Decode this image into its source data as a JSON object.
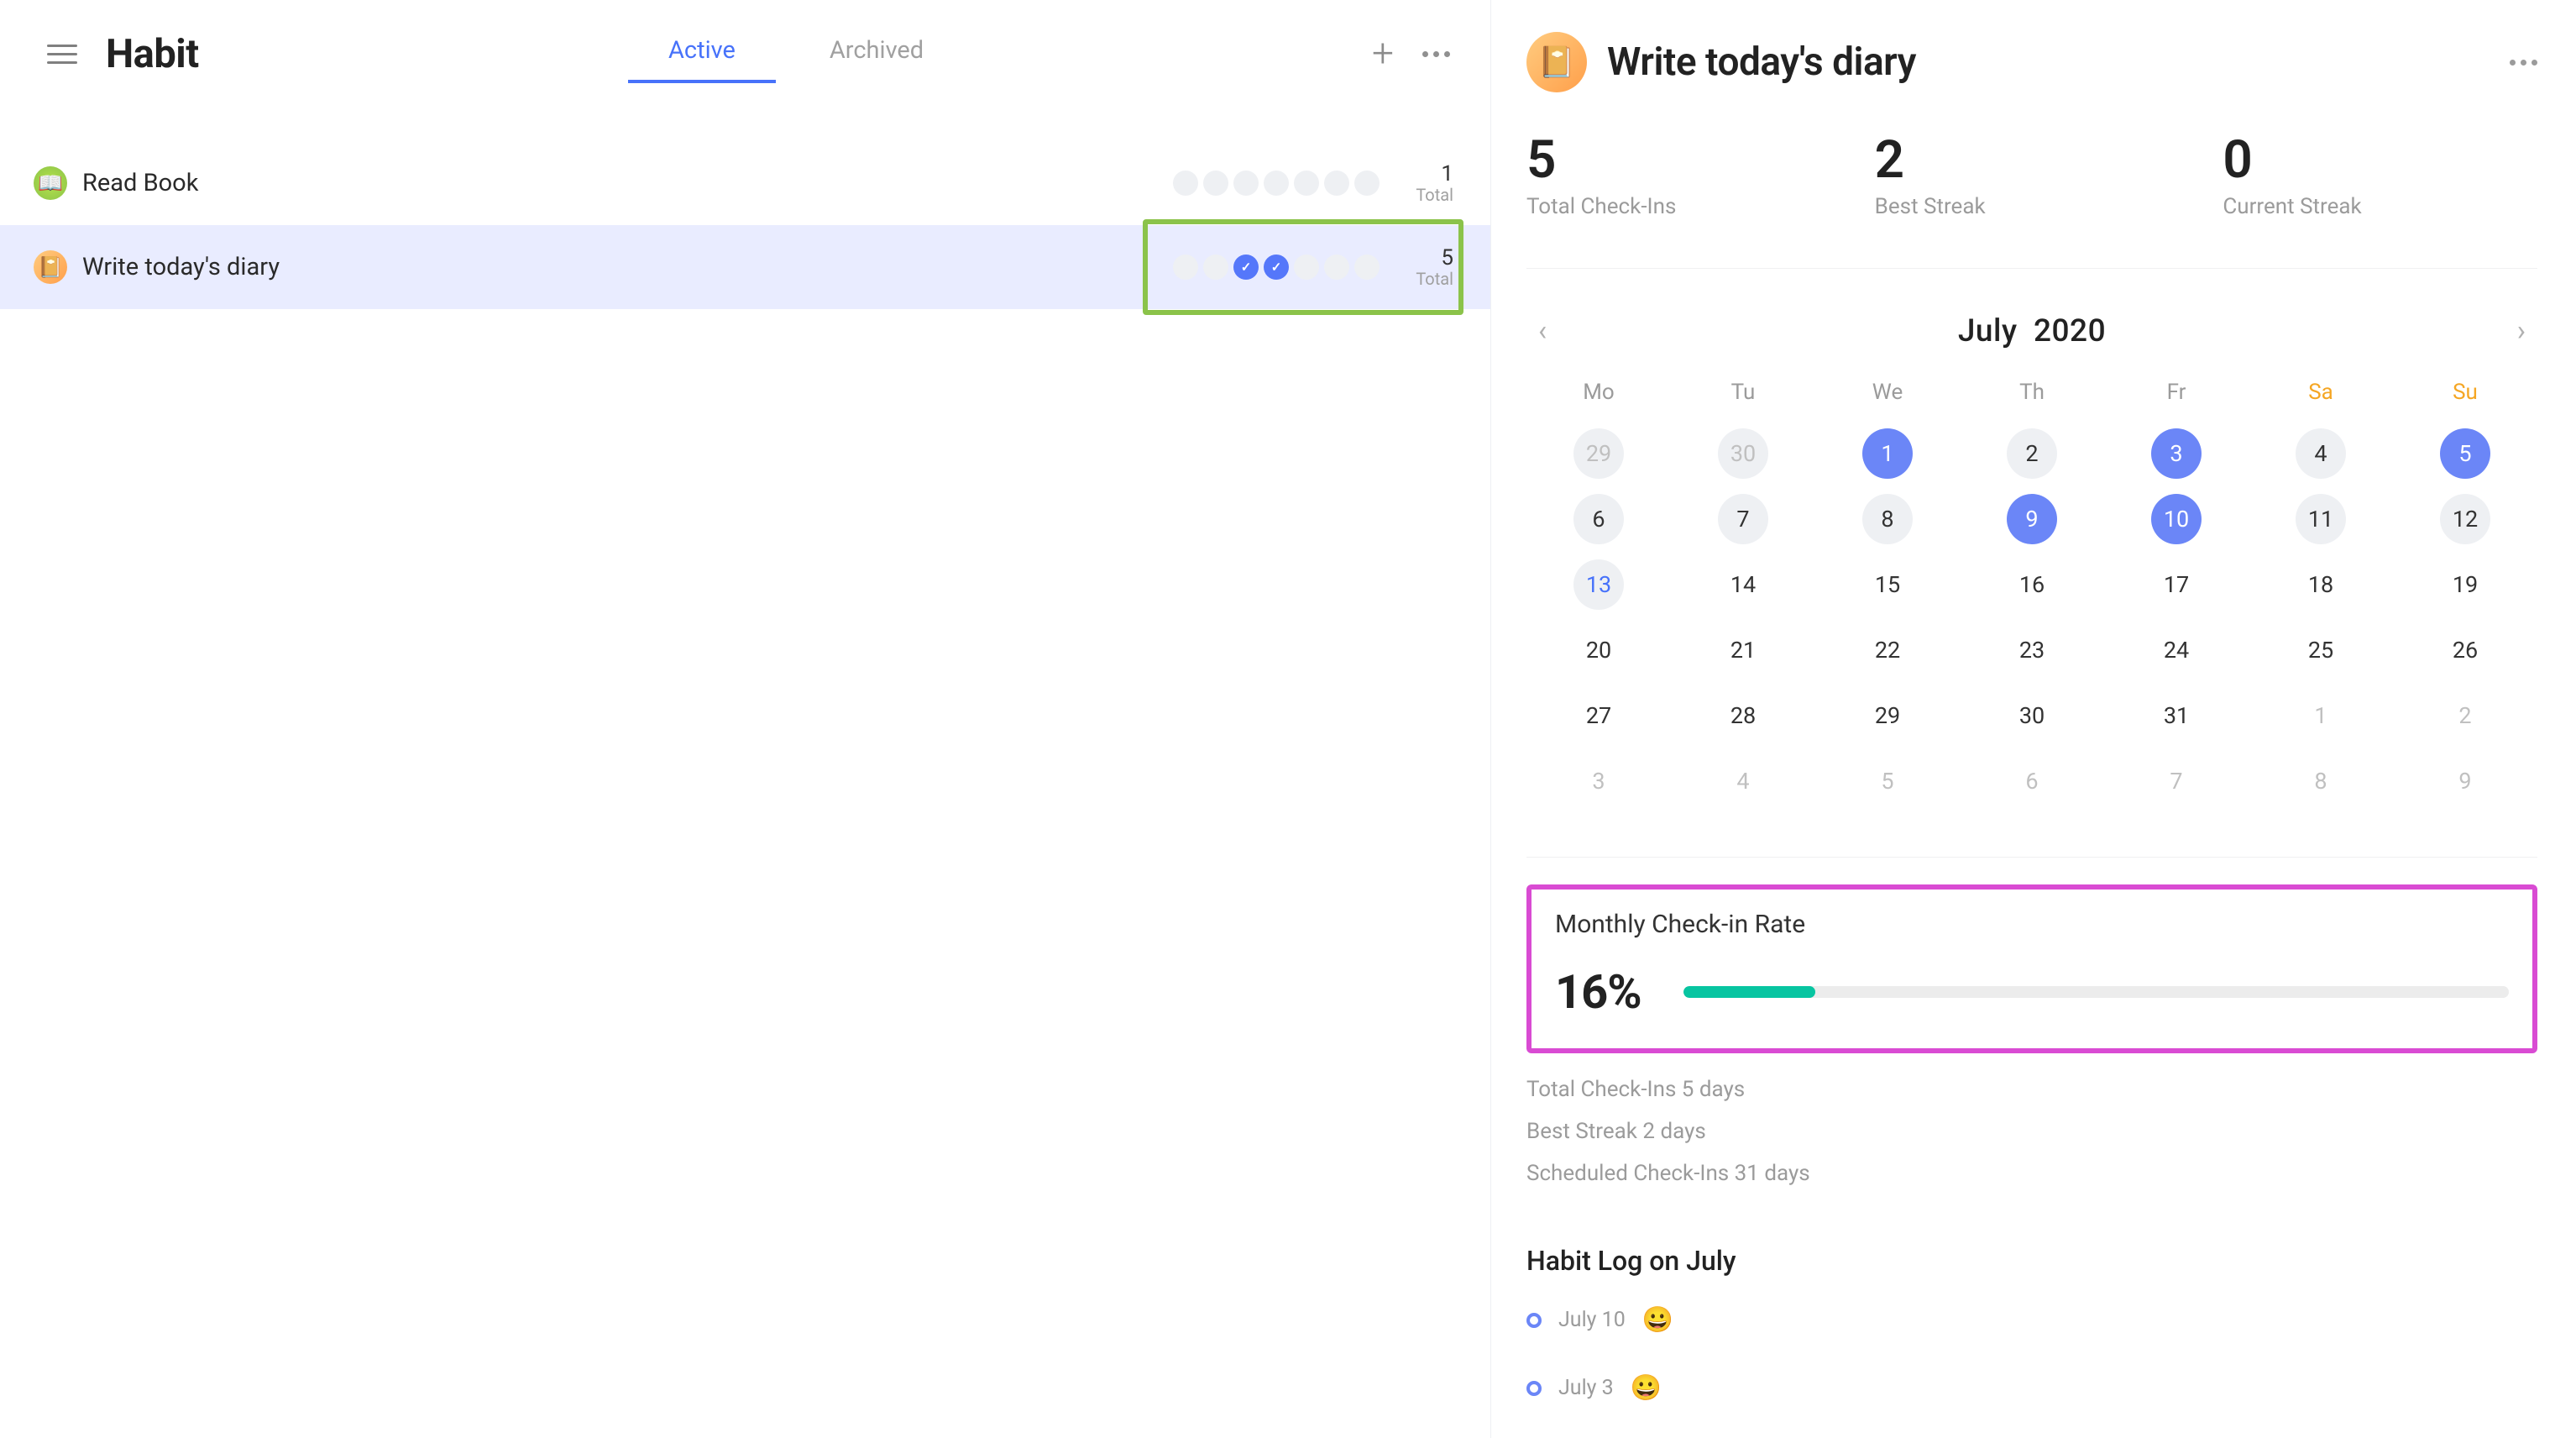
{
  "leftPanel": {
    "title": "Habit",
    "tabs": {
      "active": "Active",
      "archived": "Archived"
    },
    "habits": [
      {
        "name": "Read Book",
        "iconColor": "green",
        "count": "1",
        "countLabel": "Total",
        "days": [
          false,
          false,
          false,
          false,
          false,
          false,
          false
        ]
      },
      {
        "name": "Write today's diary",
        "iconColor": "orange",
        "count": "5",
        "countLabel": "Total",
        "days": [
          false,
          false,
          true,
          true,
          false,
          false,
          false
        ],
        "selected": true,
        "highlight": true
      }
    ]
  },
  "detail": {
    "title": "Write today's diary",
    "stats": [
      {
        "value": "5",
        "label": "Total Check-Ins"
      },
      {
        "value": "2",
        "label": "Best Streak"
      },
      {
        "value": "0",
        "label": "Current Streak"
      }
    ],
    "calendar": {
      "month": "July",
      "year": "2020",
      "dow": [
        "Mo",
        "Tu",
        "We",
        "Th",
        "Fr",
        "Sa",
        "Su"
      ],
      "weekendIdx": [
        5,
        6
      ],
      "cells": [
        {
          "n": "29",
          "cls": "out scheduled"
        },
        {
          "n": "30",
          "cls": "out scheduled"
        },
        {
          "n": "1",
          "cls": "checked"
        },
        {
          "n": "2",
          "cls": "scheduled"
        },
        {
          "n": "3",
          "cls": "checked"
        },
        {
          "n": "4",
          "cls": "scheduled"
        },
        {
          "n": "5",
          "cls": "checked"
        },
        {
          "n": "6",
          "cls": "scheduled"
        },
        {
          "n": "7",
          "cls": "scheduled"
        },
        {
          "n": "8",
          "cls": "scheduled"
        },
        {
          "n": "9",
          "cls": "checked"
        },
        {
          "n": "10",
          "cls": "checked"
        },
        {
          "n": "11",
          "cls": "scheduled"
        },
        {
          "n": "12",
          "cls": "scheduled"
        },
        {
          "n": "13",
          "cls": "scheduled today-num"
        },
        {
          "n": "14",
          "cls": ""
        },
        {
          "n": "15",
          "cls": ""
        },
        {
          "n": "16",
          "cls": ""
        },
        {
          "n": "17",
          "cls": ""
        },
        {
          "n": "18",
          "cls": ""
        },
        {
          "n": "19",
          "cls": ""
        },
        {
          "n": "20",
          "cls": ""
        },
        {
          "n": "21",
          "cls": ""
        },
        {
          "n": "22",
          "cls": ""
        },
        {
          "n": "23",
          "cls": ""
        },
        {
          "n": "24",
          "cls": ""
        },
        {
          "n": "25",
          "cls": ""
        },
        {
          "n": "26",
          "cls": ""
        },
        {
          "n": "27",
          "cls": ""
        },
        {
          "n": "28",
          "cls": ""
        },
        {
          "n": "29",
          "cls": ""
        },
        {
          "n": "30",
          "cls": ""
        },
        {
          "n": "31",
          "cls": ""
        },
        {
          "n": "1",
          "cls": "out"
        },
        {
          "n": "2",
          "cls": "out"
        },
        {
          "n": "3",
          "cls": "out"
        },
        {
          "n": "4",
          "cls": "out"
        },
        {
          "n": "5",
          "cls": "out"
        },
        {
          "n": "6",
          "cls": "out"
        },
        {
          "n": "7",
          "cls": "out"
        },
        {
          "n": "8",
          "cls": "out"
        },
        {
          "n": "9",
          "cls": "out"
        }
      ]
    },
    "rate": {
      "label": "Monthly Check-in Rate",
      "percent": "16%",
      "fill": 16
    },
    "miniStats": [
      "Total Check-Ins 5 days",
      "Best Streak 2 days",
      "Scheduled Check-Ins 31 days"
    ],
    "log": {
      "title": "Habit Log on July",
      "entries": [
        {
          "date": "July 10",
          "emoji": "😀"
        },
        {
          "date": "July 3",
          "emoji": "😀"
        }
      ]
    }
  }
}
